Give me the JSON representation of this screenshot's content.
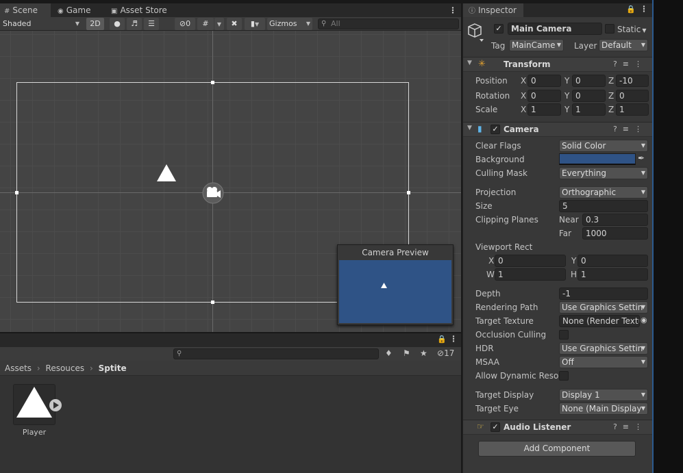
{
  "scene_tabs": [
    {
      "label": "Scene",
      "icon": "grid-icon"
    },
    {
      "label": "Game",
      "icon": "gamepad-icon"
    },
    {
      "label": "Asset Store",
      "icon": "shopping-bag-icon"
    }
  ],
  "scene_toolbar": {
    "draw_mode": "Shaded",
    "mode_2d": "2D",
    "hidden_count": "0",
    "gizmos": "Gizmos",
    "search_placeholder": "All"
  },
  "camera_preview": {
    "title": "Camera Preview",
    "background_color": "#2f5386"
  },
  "project": {
    "hidden_count": "17",
    "breadcrumb": [
      "Assets",
      "Resouces",
      "Sptite"
    ],
    "assets": [
      {
        "name": "Player"
      }
    ]
  },
  "inspector": {
    "tab": "Inspector",
    "object_name": "Main Camera",
    "active": true,
    "static_label": "Static",
    "tag_label": "Tag",
    "tag_value": "MainCame",
    "layer_label": "Layer",
    "layer_value": "Default",
    "transform": {
      "title": "Transform",
      "rows": [
        {
          "label": "Position",
          "x": "0",
          "y": "0",
          "z": "-10"
        },
        {
          "label": "Rotation",
          "x": "0",
          "y": "0",
          "z": "0"
        },
        {
          "label": "Scale",
          "x": "1",
          "y": "1",
          "z": "1"
        }
      ]
    },
    "camera": {
      "title": "Camera",
      "enabled": true,
      "clear_flags_label": "Clear Flags",
      "clear_flags": "Solid Color",
      "background_label": "Background",
      "background_color": "#2f5386",
      "culling_mask_label": "Culling Mask",
      "culling_mask": "Everything",
      "projection_label": "Projection",
      "projection": "Orthographic",
      "size_label": "Size",
      "size": "5",
      "clipping_label": "Clipping Planes",
      "near_label": "Near",
      "near": "0.3",
      "far_label": "Far",
      "far": "1000",
      "viewport_label": "Viewport Rect",
      "vx": "0",
      "vy": "0",
      "vw": "1",
      "vh": "1",
      "depth_label": "Depth",
      "depth": "-1",
      "rendering_path_label": "Rendering Path",
      "rendering_path": "Use Graphics Settin",
      "target_texture_label": "Target Texture",
      "target_texture": "None (Render Textu",
      "occlusion_label": "Occlusion Culling",
      "hdr_label": "HDR",
      "hdr": "Use Graphics Settin",
      "msaa_label": "MSAA",
      "msaa": "Off",
      "dynamic_res_label": "Allow Dynamic Resol",
      "target_display_label": "Target Display",
      "target_display": "Display 1",
      "target_eye_label": "Target Eye",
      "target_eye": "None (Main Display"
    },
    "audio_listener": {
      "title": "Audio Listener",
      "enabled": true
    },
    "add_component": "Add Component"
  }
}
